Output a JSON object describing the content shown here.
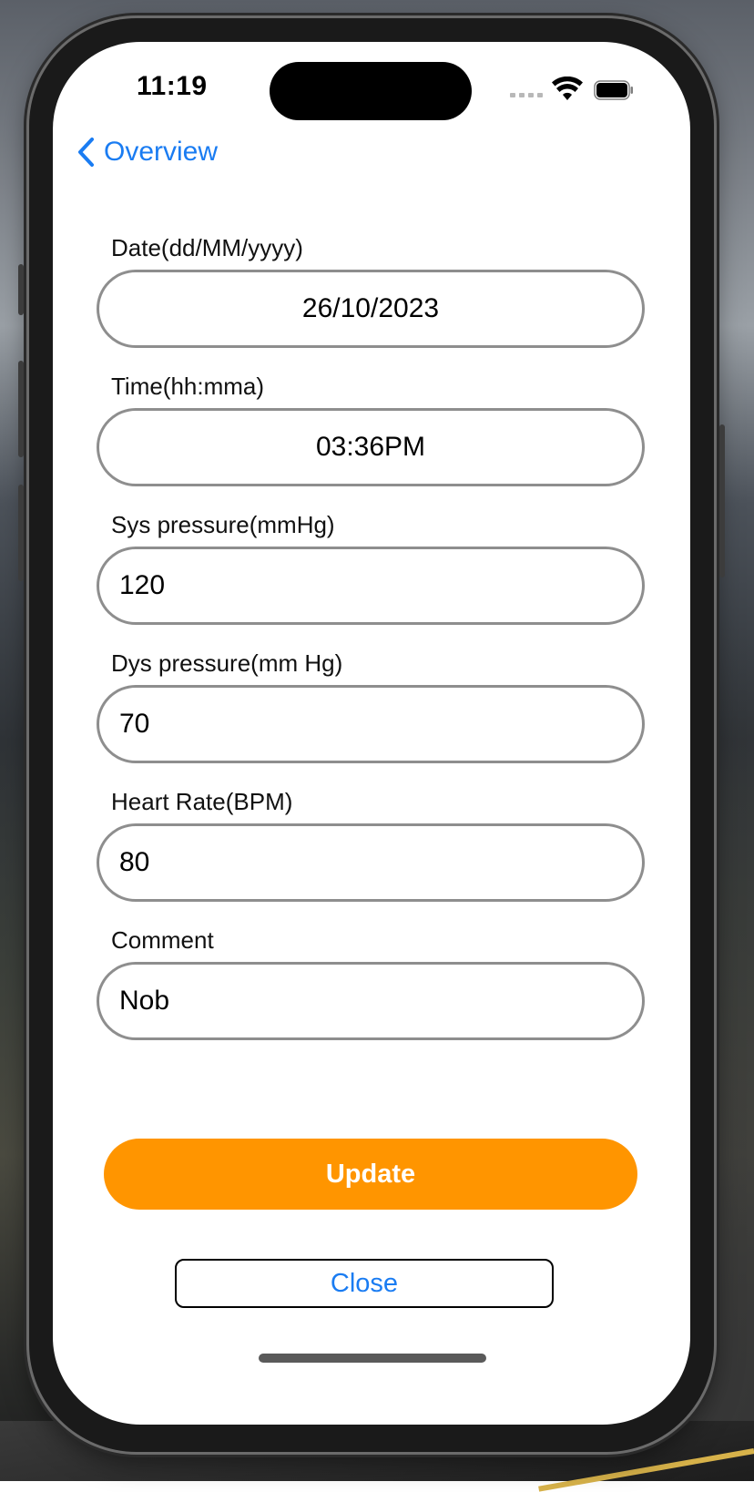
{
  "status_bar": {
    "time": "11:19"
  },
  "nav": {
    "back_label": "Overview"
  },
  "form": {
    "fields": [
      {
        "label": "Date(dd/MM/yyyy)",
        "value": "26/10/2023"
      },
      {
        "label": "Time(hh:mma)",
        "value": "03:36PM"
      },
      {
        "label": "Sys pressure(mmHg)",
        "value": "120"
      },
      {
        "label": "Dys pressure(mm Hg)",
        "value": "70"
      },
      {
        "label": "Heart Rate(BPM)",
        "value": "80"
      },
      {
        "label": "Comment",
        "value": "Nob"
      }
    ]
  },
  "actions": {
    "update_label": "Update",
    "close_label": "Close"
  },
  "colors": {
    "accent": "#1a7cf2",
    "update_button": "#ff9500",
    "field_border": "#8e8e8e"
  },
  "icons": {
    "back": "chevron-left-icon",
    "wifi": "wifi-icon",
    "battery": "battery-icon",
    "signal": "cellular-signal-icon"
  }
}
